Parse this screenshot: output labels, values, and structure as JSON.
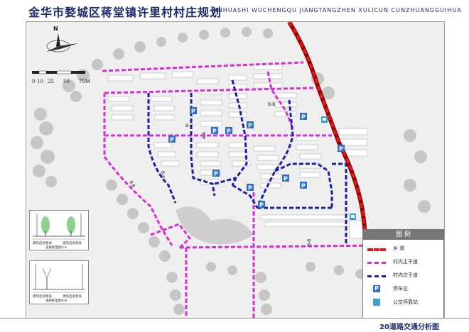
{
  "header": {
    "title_cn": "金华市婺城区蒋堂镇许里村村庄规划",
    "title_pinyin": "JINHUASHI WUCHENGQU JIANGTANGZHEN XULICUN CUNZHUANGGUIHUA"
  },
  "compass": {
    "north_label": "N"
  },
  "scale_bar": {
    "labels": [
      "0",
      "10",
      "25",
      "50",
      "75M"
    ]
  },
  "map_labels": {
    "section_aa": "A-A",
    "section_bb": "B-B",
    "parking_symbol": "P"
  },
  "sections": [
    {
      "title": "道路断面图A-A",
      "left_label": "建筑后退距离",
      "right_label": "建筑后退距离"
    },
    {
      "title": "道路断面图B-B",
      "left_label": "建筑后退距离",
      "right_label": "建筑后退距离"
    }
  ],
  "legend": {
    "title": "图  例",
    "items": [
      {
        "label": "乡  道",
        "color": "#dd1a1a",
        "style": "dash-thick"
      },
      {
        "label": "村内主干道",
        "color": "#d62fd6",
        "style": "dash"
      },
      {
        "label": "村内次干道",
        "color": "#1f1fa6",
        "style": "dash"
      },
      {
        "label": "停车位",
        "icon": "parking-icon",
        "color": "#2c6fd0"
      },
      {
        "label": "公交停靠站",
        "icon": "bus-stop-icon",
        "color": "#3aa0d8"
      }
    ]
  },
  "footer": {
    "figure_title": "20道路交通分析图"
  },
  "colors": {
    "township_road": "#dd1a1a",
    "main_road": "#d62fd6",
    "secondary_road": "#1f1fa6",
    "parking": "#2c6fd0",
    "bus_stop": "#3aa0d8"
  }
}
